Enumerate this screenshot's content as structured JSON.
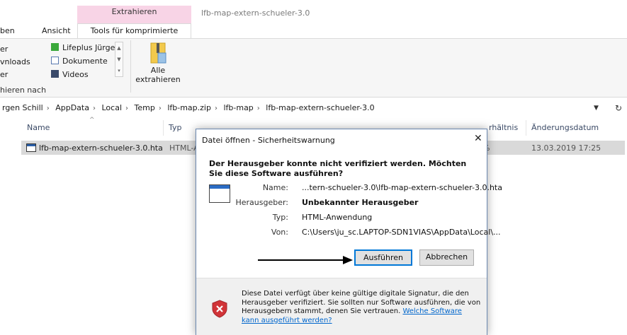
{
  "window": {
    "title": "lfb-map-extern-schueler-3.0",
    "context_header": "Extrahieren"
  },
  "ribbon_tabs": {
    "ben": "ben",
    "ansicht": "Ansicht",
    "tools": "Tools für komprimierte Ordner"
  },
  "ribbon": {
    "left_items": [
      "er",
      "vnloads",
      "er"
    ],
    "locations": [
      "Lifeplus Jürgen",
      "Dokumente",
      "Videos"
    ],
    "extract_all_line1": "Alle",
    "extract_all_line2": "extrahieren",
    "group_label": "hieren nach"
  },
  "address": {
    "crumbs": [
      "rgen Schill",
      "AppData",
      "Local",
      "Temp",
      "lfb-map.zip",
      "lfb-map",
      "lfb-map-extern-schueler-3.0"
    ],
    "separator": "›"
  },
  "columns": {
    "name": "Name",
    "type": "Typ",
    "ratio": "rhältnis",
    "date": "Änderungsdatum"
  },
  "file": {
    "name": "lfb-map-extern-schueler-3.0.hta",
    "type": "HTML-A",
    "percent": "%",
    "date": "13.03.2019 17:25"
  },
  "dialog": {
    "title": "Datei öffnen - Sicherheitswarnung",
    "heading": "Der Herausgeber konnte nicht verifiziert werden. Möchten Sie diese Software ausführen?",
    "name_label": "Name:",
    "name_value": "...tern-schueler-3.0\\lfb-map-extern-schueler-3.0.hta",
    "publisher_label": "Herausgeber:",
    "publisher_value": "Unbekannter Herausgeber",
    "type_label": "Typ:",
    "type_value": "HTML-Anwendung",
    "from_label": "Von:",
    "from_value": "C:\\Users\\ju_sc.LAPTOP-SDN1VIAS\\AppData\\Local\\...",
    "run_button": "Ausführen",
    "cancel_button": "Abbrechen",
    "footer_text": "Diese Datei verfügt über keine gültige digitale Signatur, die den Herausgeber verifiziert. Sie sollten nur Software ausführen, die von Herausgebern stammt, denen Sie vertrauen.",
    "footer_link": "Welche Software kann ausgeführt werden?"
  },
  "colors": {
    "context_tab": "#f8d4e6",
    "selection": "#d9d9d9",
    "primary_border": "#0078d7",
    "link": "#0066cc"
  }
}
